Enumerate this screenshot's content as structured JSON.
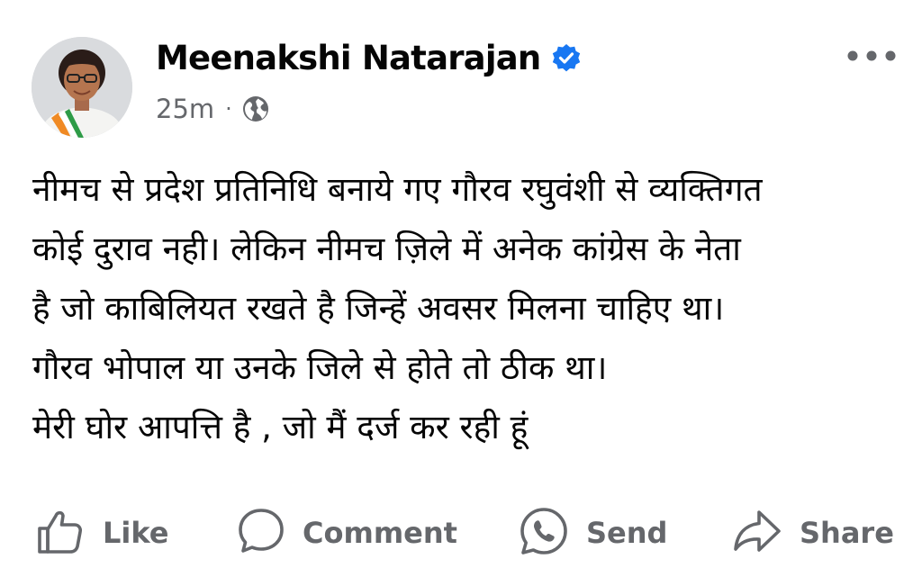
{
  "post": {
    "author": "Meenakshi Natarajan",
    "verified_icon": "verified-badge-icon",
    "time": "25m",
    "separator": "·",
    "audience_icon": "globe-icon",
    "more_icon": "more-options-icon",
    "lines": [
      "नीमच से प्रदेश प्रतिनिधि बनाये गए गौरव रघुवंशी से व्यक्तिगत",
      "कोई दुराव नही। लेकिन नीमच ज़िले में अनेक कांग्रेस के नेता",
      "है जो काबिलियत रखते है जिन्हें अवसर मिलना चाहिए था।",
      "गौरव भोपाल या उनके जिले से होते तो ठीक था।",
      "मेरी घोर आपत्ति है , जो मैं दर्ज कर रही हूं"
    ]
  },
  "actions": {
    "like": "Like",
    "comment": "Comment",
    "send": "Send",
    "share": "Share"
  },
  "colors": {
    "text": "#050505",
    "secondary": "#65676b",
    "verified": "#1877f2"
  }
}
